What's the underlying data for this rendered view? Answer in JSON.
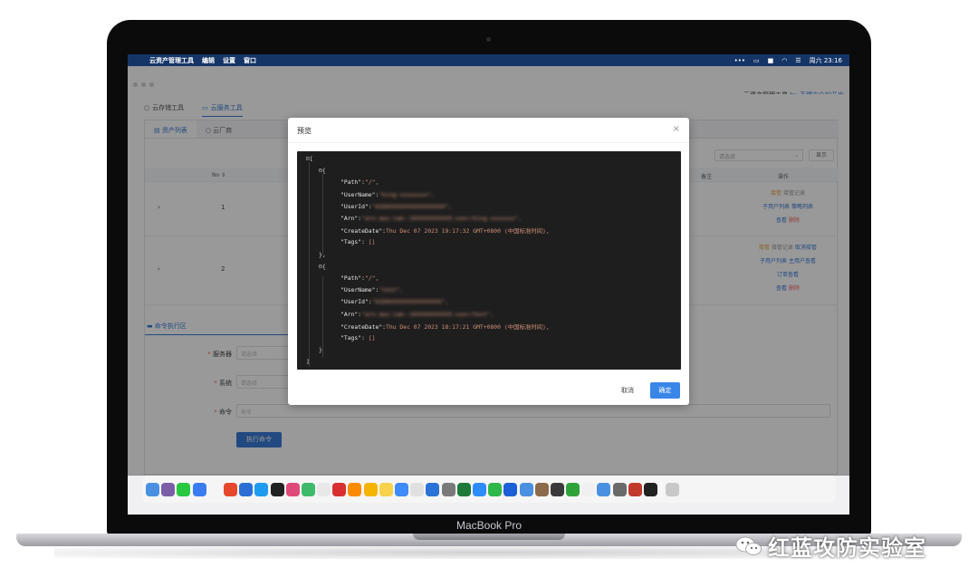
{
  "menubar": {
    "app_name": "云资产管理工具",
    "items": [
      "编辑",
      "设置",
      "窗口"
    ],
    "clock": "周六 23:16"
  },
  "window": {
    "brand_prefix": "云资产管理工具",
    "brand_by": "by 不懂安全的开发"
  },
  "top_tabs": [
    {
      "label": "云存储工具",
      "icon": "circle-icon"
    },
    {
      "label": "云服务工具",
      "icon": "monitor-icon",
      "active": true
    }
  ],
  "inner_tabs": [
    {
      "label": "资产列表",
      "active": true
    },
    {
      "label": "云厂商"
    }
  ],
  "filters": {
    "select_placeholder": "请选择",
    "show_button": "显示"
  },
  "table": {
    "headers": {
      "no": "No ⇕",
      "remark": "备注",
      "ops": "操作"
    },
    "rows": [
      {
        "no": "1",
        "ops": [
          [
            "接管",
            "接管记录"
          ],
          [
            "子用户列表",
            "策略列表"
          ],
          [
            "查看",
            "删除"
          ]
        ]
      },
      {
        "no": "2",
        "ops": [
          [
            "接管",
            "接管记录",
            "取消接管"
          ],
          [
            "子用户列表",
            "主用户查看"
          ],
          [
            "订单查看"
          ],
          [
            "查看",
            "删除"
          ]
        ]
      }
    ]
  },
  "command": {
    "section_title": "命令执行区",
    "fields": [
      {
        "label": "服务器",
        "placeholder": "请选择",
        "required": true
      },
      {
        "label": "系统",
        "placeholder": "请选择",
        "required": true
      },
      {
        "label": "命令",
        "placeholder": "命令",
        "required": true
      }
    ],
    "execute_button": "执行命令"
  },
  "dialog": {
    "title": "预览",
    "close": "×",
    "cancel": "取消",
    "confirm": "确定",
    "json_lines": [
      {
        "indent": 0,
        "text": "[",
        "fold": true
      },
      {
        "indent": 1,
        "text": "{",
        "fold": true
      },
      {
        "indent": 2,
        "key": "\"Path\"",
        "value": "\"/\","
      },
      {
        "indent": 2,
        "key": "\"UserName\"",
        "value": "\"king-xxxxxxxx\",",
        "blurred": true
      },
      {
        "indent": 2,
        "key": "\"UserId\"",
        "value": "\"AIDAXXXXXXXXXXXXXXXX\",",
        "blurred": true
      },
      {
        "indent": 2,
        "key": "\"Arn\"",
        "value": "\"arn:aws:iam::XXXXXXXXXXXX:user/king-xxxxxxx\",",
        "blurred": true
      },
      {
        "indent": 2,
        "key": "\"CreateDate\"",
        "value": "Thu Dec 07 2023 19:17:32 GMT+0800 (中国标准时间),"
      },
      {
        "indent": 2,
        "key": "\"Tags\"",
        "value": " []"
      },
      {
        "indent": 1,
        "text": "},"
      },
      {
        "indent": 1,
        "text": "{",
        "fold": true
      },
      {
        "indent": 2,
        "key": "\"Path\"",
        "value": "\"/\","
      },
      {
        "indent": 2,
        "key": "\"UserName\"",
        "value": "\"test\",",
        "blurred": true
      },
      {
        "indent": 2,
        "key": "\"UserId\"",
        "value": "\"AIDAXXXXXXXXXXXXXXX\",",
        "blurred": true
      },
      {
        "indent": 2,
        "key": "\"Arn\"",
        "value": "\"arn:aws:iam::XXXXXXXXXXXX:user/test\",",
        "blurred": true
      },
      {
        "indent": 2,
        "key": "\"CreateDate\"",
        "value": "Thu Dec 07 2023 18:17:21 GMT+0800 (中国标准时间),"
      },
      {
        "indent": 2,
        "key": "\"Tags\"",
        "value": " []"
      },
      {
        "indent": 1,
        "text": "}"
      },
      {
        "indent": 0,
        "text": "]"
      }
    ]
  },
  "dock": {
    "colors": [
      "#4a90e2",
      "#7b5ea7",
      "#28c840",
      "#3b7df0",
      "#f5f5f5",
      "#e6482b",
      "#2b6fd6",
      "#1f9cf0",
      "#222222",
      "#e04a7a",
      "#3fba6a",
      "#e8e8e8",
      "#d83030",
      "#fb8c00",
      "#f5b400",
      "#f7d24a",
      "#3d8bfd",
      "#e0e0e0",
      "#2a72d6",
      "#7a7a7a",
      "#1d7a3a",
      "#2d8cff",
      "#2fb74a",
      "#1c5fd6",
      "#4a8fe0",
      "#8b6b4a",
      "#3a3a3a",
      "#2fa33a",
      "#f0f0f0",
      "#4a90e2",
      "#6a6a6a",
      "#c0392b",
      "#222222",
      "#c8c8c8"
    ]
  },
  "laptop": {
    "model": "MacBook Pro"
  },
  "watermark": {
    "text": "红蓝攻防实验室"
  }
}
